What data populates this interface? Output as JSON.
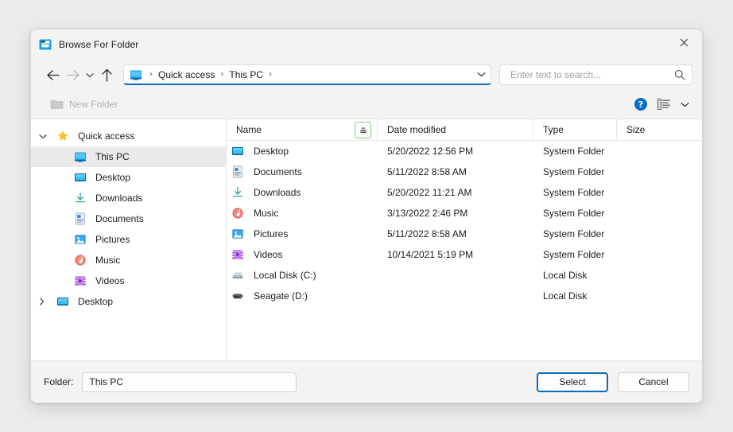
{
  "window": {
    "title": "Browse For Folder",
    "title_icon": "folder-window-icon",
    "close_icon": "close-icon"
  },
  "nav": {
    "back_icon": "back-arrow-icon",
    "forward_icon": "forward-arrow-icon",
    "history_icon": "chevron-down-icon",
    "up_icon": "up-arrow-icon",
    "address": {
      "root_icon": "this-pc-icon",
      "separator": "›",
      "crumbs": [
        "Quick access",
        "This PC"
      ],
      "dropdown_icon": "chevron-down-icon"
    },
    "search": {
      "placeholder": "Enter text to search...",
      "value": "",
      "icon": "search-icon"
    }
  },
  "commandbar": {
    "new_folder_label": "New Folder",
    "new_folder_icon": "new-folder-icon",
    "new_folder_enabled": false,
    "help_icon": "help-icon",
    "help_glyph": "?",
    "view_icon": "list-view-icon",
    "view_chevron": "chevron-down-icon"
  },
  "tree": {
    "nodes": [
      {
        "label": "Quick access",
        "icon": "star-icon",
        "arrow": "expanded",
        "level": 0,
        "selected": false
      },
      {
        "label": "This PC",
        "icon": "this-pc-icon",
        "arrow": "none",
        "level": 1,
        "selected": true
      },
      {
        "label": "Desktop",
        "icon": "desktop-icon",
        "arrow": "none",
        "level": 1,
        "selected": false
      },
      {
        "label": "Downloads",
        "icon": "downloads-icon",
        "arrow": "none",
        "level": 1,
        "selected": false
      },
      {
        "label": "Documents",
        "icon": "documents-icon",
        "arrow": "none",
        "level": 1,
        "selected": false
      },
      {
        "label": "Pictures",
        "icon": "pictures-icon",
        "arrow": "none",
        "level": 1,
        "selected": false
      },
      {
        "label": "Music",
        "icon": "music-icon",
        "arrow": "none",
        "level": 1,
        "selected": false
      },
      {
        "label": "Videos",
        "icon": "videos-icon",
        "arrow": "none",
        "level": 1,
        "selected": false
      },
      {
        "label": "Desktop",
        "icon": "desktop-icon",
        "arrow": "collapsed",
        "level": 0,
        "selected": false
      }
    ],
    "arrow_expanded_glyph": "⌄",
    "arrow_collapsed_glyph": "›"
  },
  "list": {
    "columns": [
      "Name",
      "Date modified",
      "Type",
      "Size"
    ],
    "sort_button_icon": "sort-filter-icon",
    "rows": [
      {
        "name": "Desktop",
        "icon": "desktop-icon",
        "date": "5/20/2022 12:56 PM",
        "type": "System Folder",
        "size": ""
      },
      {
        "name": "Documents",
        "icon": "documents-icon",
        "date": "5/11/2022 8:58 AM",
        "type": "System Folder",
        "size": ""
      },
      {
        "name": "Downloads",
        "icon": "downloads-icon",
        "date": "5/20/2022 11:21 AM",
        "type": "System Folder",
        "size": ""
      },
      {
        "name": "Music",
        "icon": "music-icon",
        "date": "3/13/2022 2:46 PM",
        "type": "System Folder",
        "size": ""
      },
      {
        "name": "Pictures",
        "icon": "pictures-icon",
        "date": "5/11/2022 8:58 AM",
        "type": "System Folder",
        "size": ""
      },
      {
        "name": "Videos",
        "icon": "videos-icon",
        "date": "10/14/2021 5:19 PM",
        "type": "System Folder",
        "size": ""
      },
      {
        "name": "Local Disk (C:)",
        "icon": "local-disk-icon",
        "date": "",
        "type": "Local Disk",
        "size": ""
      },
      {
        "name": "Seagate (D:)",
        "icon": "external-drive-icon",
        "date": "",
        "type": "Local Disk",
        "size": ""
      }
    ]
  },
  "footer": {
    "folder_label": "Folder:",
    "folder_value": "This PC",
    "select_label": "Select",
    "cancel_label": "Cancel"
  },
  "colors": {
    "accent": "#0f6cbd",
    "help_blue": "#0c6ec6",
    "star_gold": "#f7c11e",
    "selection_gray": "#eaeaea",
    "page_background": "#ebebeb",
    "dialog_background": "#f3f3f3"
  }
}
